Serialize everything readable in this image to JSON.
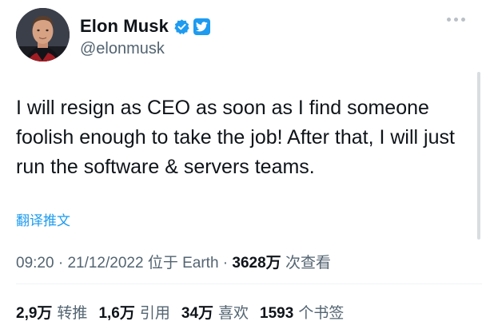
{
  "author": {
    "name": "Elon Musk",
    "handle": "@elonmusk"
  },
  "tweet": {
    "text": "I will resign as CEO as soon as I find someone foolish enough to take the job! After that, I will just run the software & servers teams.",
    "translate_label": "翻译推文"
  },
  "meta": {
    "time": "09:20",
    "date": "21/12/2022",
    "location_prefix": "位于",
    "location": "Earth",
    "views_count": "3628万",
    "views_label": "次查看"
  },
  "stats": {
    "retweets": {
      "count": "2,9万",
      "label": "转推"
    },
    "quotes": {
      "count": "1,6万",
      "label": "引用"
    },
    "likes": {
      "count": "34万",
      "label": "喜欢"
    },
    "bookmarks": {
      "count": "1593",
      "label": "个书签"
    }
  },
  "colors": {
    "link_blue": "#1d9bf0",
    "text_primary": "#0f1419",
    "text_secondary": "#536471"
  },
  "icons": {
    "verified": "verified-badge-icon",
    "twitter": "twitter-bird-icon",
    "more": "more-options-icon"
  }
}
